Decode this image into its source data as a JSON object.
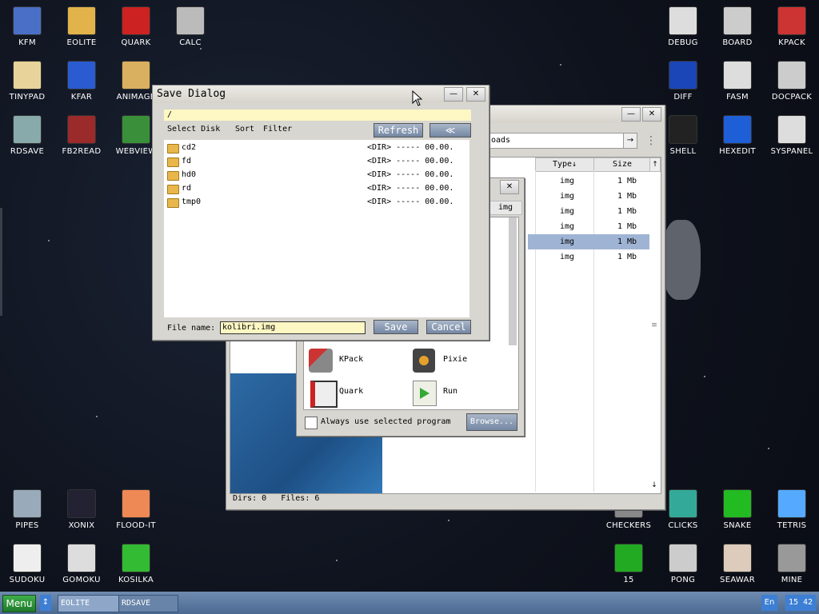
{
  "desktop": {
    "icons": [
      {
        "label": "KFM",
        "icon": "floppy-icon"
      },
      {
        "label": "EOLITE",
        "icon": "folder-icon"
      },
      {
        "label": "QUARK",
        "icon": "book-icon"
      },
      {
        "label": "CALC",
        "icon": "calculator-icon"
      },
      {
        "label": "TINYPAD",
        "icon": "notepad-icon"
      },
      {
        "label": "KFAR",
        "icon": "archive-icon"
      },
      {
        "label": "ANIMAGE",
        "icon": "paint-icon"
      },
      {
        "label": "RDSAVE",
        "icon": "disk-save-icon"
      },
      {
        "label": "FB2READ",
        "icon": "ebook-icon"
      },
      {
        "label": "WEBVIEW",
        "icon": "globe-icon"
      },
      {
        "label": "DEBUG",
        "icon": "bug-icon"
      },
      {
        "label": "BOARD",
        "icon": "board-icon"
      },
      {
        "label": "KPACK",
        "icon": "wrench-icon"
      },
      {
        "label": "DIFF",
        "icon": "diff-icon"
      },
      {
        "label": "FASM",
        "icon": "anvil-icon"
      },
      {
        "label": "DOCPACK",
        "icon": "cabinet-icon"
      },
      {
        "label": "SHELL",
        "icon": "terminal-icon"
      },
      {
        "label": "HEXEDIT",
        "icon": "hex-icon"
      },
      {
        "label": "SYSPANEL",
        "icon": "panel-icon"
      },
      {
        "label": "PIPES",
        "icon": "pipes-icon"
      },
      {
        "label": "XONIX",
        "icon": "xonix-icon"
      },
      {
        "label": "FLOOD-IT",
        "icon": "flood-icon"
      },
      {
        "label": "SUDOKU",
        "icon": "sudoku-icon"
      },
      {
        "label": "GOMOKU",
        "icon": "gomoku-icon"
      },
      {
        "label": "KOSILKA",
        "icon": "mower-icon"
      },
      {
        "label": "CHECKERS",
        "icon": "checkers-icon"
      },
      {
        "label": "CLICKS",
        "icon": "clicks-icon"
      },
      {
        "label": "SNAKE",
        "icon": "snake-icon"
      },
      {
        "label": "TETRIS",
        "icon": "tetris-icon"
      },
      {
        "label": "15",
        "icon": "fifteen-icon"
      },
      {
        "label": "PONG",
        "icon": "pong-icon"
      },
      {
        "label": "SEAWAR",
        "icon": "seawar-icon"
      },
      {
        "label": "MINE",
        "icon": "mine-icon"
      }
    ]
  },
  "save_dialog": {
    "title": "Save Dialog",
    "path": "/",
    "menu": [
      "Select Disk",
      "Sort",
      "Filter"
    ],
    "refresh_label": "Refresh",
    "up_label": "≪",
    "entries": [
      {
        "name": "cd2",
        "type": "<DIR>",
        "size": "-----",
        "date": "00.00."
      },
      {
        "name": "fd",
        "type": "<DIR>",
        "size": "-----",
        "date": "00.00."
      },
      {
        "name": "hd0",
        "type": "<DIR>",
        "size": "-----",
        "date": "00.00."
      },
      {
        "name": "rd",
        "type": "<DIR>",
        "size": "-----",
        "date": "00.00."
      },
      {
        "name": "tmp0",
        "type": "<DIR>",
        "size": "-----",
        "date": "00.00."
      }
    ],
    "filename_label": "File name:",
    "filename_value": "kolibri.img",
    "save_label": "Save",
    "cancel_label": "Cancel"
  },
  "file_manager": {
    "address": "oads",
    "go_label": "→",
    "col_type": "Type↓",
    "col_size": "Size",
    "rows": [
      {
        "type": "img",
        "size": "1 Mb"
      },
      {
        "type": "img",
        "size": "1 Mb"
      },
      {
        "type": "img",
        "size": "1 Mb"
      },
      {
        "type": "img",
        "size": "1 Mb"
      },
      {
        "type": "img",
        "size": "1 Mb"
      },
      {
        "type": "img",
        "size": "1 Mb"
      }
    ],
    "status_dirs": "Dirs: 0",
    "status_files": "Files: 6"
  },
  "open_with": {
    "header": "img",
    "programs": [
      {
        "label": "KPack",
        "icon": "wrench-icon"
      },
      {
        "label": "Pixie",
        "icon": "speaker-icon"
      },
      {
        "label": "Quark",
        "icon": "book-icon"
      },
      {
        "label": "Run",
        "icon": "run-icon"
      }
    ],
    "always_label": "Always use selected program",
    "browse_label": "Browse..."
  },
  "taskbar": {
    "menu_label": "Menu",
    "tasks": [
      "EOLITE",
      "RDSAVE"
    ],
    "lang": "En",
    "time": "15 42"
  }
}
